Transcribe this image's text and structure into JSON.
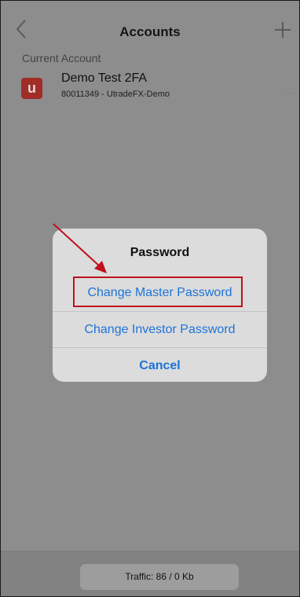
{
  "header": {
    "title": "Accounts",
    "back_icon": "chevron-left-icon",
    "add_icon": "plus-icon"
  },
  "section": {
    "label": "Current Account"
  },
  "account": {
    "logo_letter": "u",
    "name": "Demo Test 2FA",
    "details": "80011349 - UtradeFX-Demo",
    "more_label": "..."
  },
  "dialog": {
    "title": "Password",
    "options": [
      {
        "label": "Change Master Password",
        "highlighted": true
      },
      {
        "label": "Change Investor Password"
      },
      {
        "label": "Cancel"
      }
    ]
  },
  "footer": {
    "traffic": "Traffic: 86 / 0 Kb"
  },
  "colors": {
    "accent": "#1d73d9",
    "annotation_red": "#c0101b",
    "logo": "#a12d28",
    "dim_overlay": "#8d8d8d"
  }
}
